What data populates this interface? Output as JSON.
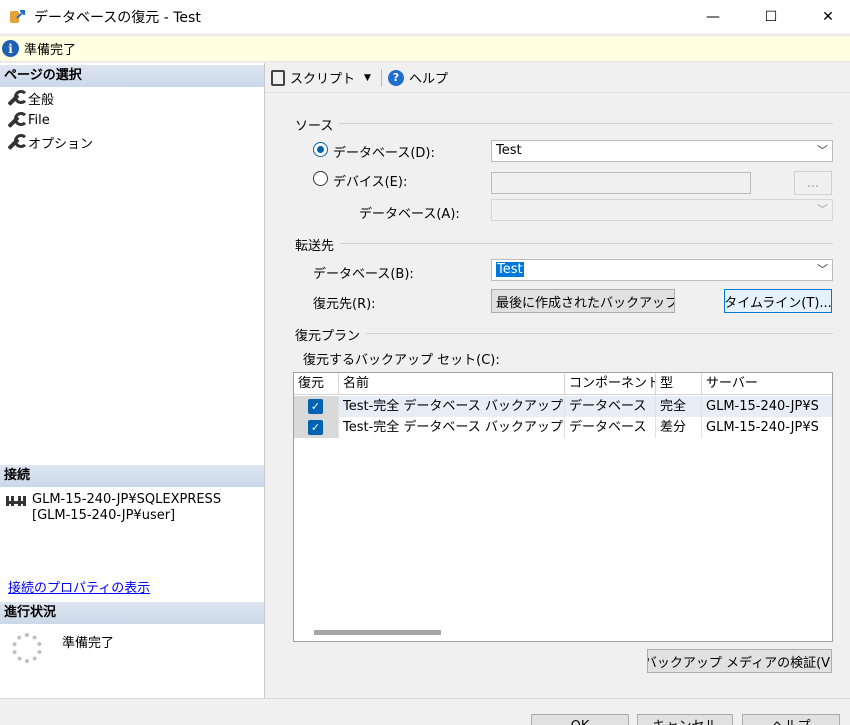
{
  "window": {
    "title": "データベースの復元 - Test",
    "min_glyph": "—",
    "max_glyph": "☐",
    "close_glyph": "✕"
  },
  "banner": {
    "status": "準備完了"
  },
  "left": {
    "page_select_header": "ページの選択",
    "pages": [
      "全般",
      "File",
      "オプション"
    ],
    "connection_header": "接続",
    "connection_server": "GLM-15-240-JP¥SQLEXPRESS",
    "connection_user": "[GLM-15-240-JP¥user]",
    "connection_link": "接続のプロパティの表示",
    "progress_header": "進行状況",
    "progress_status": "準備完了"
  },
  "toolbar": {
    "script_label": "スクリプト",
    "help_label": "ヘルプ"
  },
  "source": {
    "group_label": "ソース",
    "database_radio": "データベース(D):",
    "database_value": "Test",
    "device_radio": "デバイス(E):",
    "device_value": "",
    "browse_label": "...",
    "device_db_label": "データベース(A):",
    "device_db_value": ""
  },
  "destination": {
    "group_label": "転送先",
    "database_label": "データベース(B):",
    "database_value": "Test",
    "restore_to_label": "復元先(R):",
    "restore_to_value": "最後に作成されたバックアップ (",
    "timeline_button": "タイムライン(T)..."
  },
  "plan": {
    "group_label": "復元プラン",
    "sets_label": "復元するバックアップ セット(C):",
    "columns": [
      "復元",
      "名前",
      "コンポーネント",
      "型",
      "サーバー"
    ],
    "rows": [
      {
        "restore": true,
        "name": "Test-完全 データベース バックアップ",
        "component": "データベース",
        "type": "完全",
        "server": "GLM-15-240-JP¥S"
      },
      {
        "restore": true,
        "name": "Test-完全 データベース バックアップ",
        "component": "データベース",
        "type": "差分",
        "server": "GLM-15-240-JP¥S"
      }
    ],
    "verify_button": "バックアップ メディアの検証(V)"
  },
  "footer": {
    "ok": "OK",
    "cancel": "キャンセル",
    "help": "ヘルプ"
  },
  "colors": {
    "accent": "#0063b1",
    "banner_bg": "#ffffe1",
    "section_head": "#d3deeb"
  }
}
